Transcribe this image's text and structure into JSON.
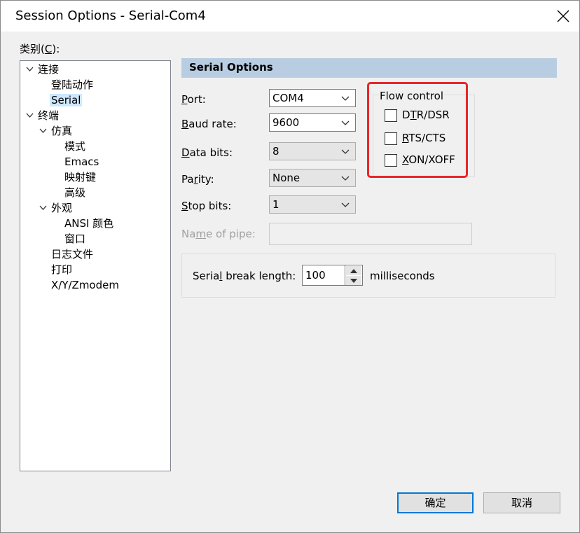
{
  "window": {
    "title": "Session Options - Serial-Com4"
  },
  "category": {
    "label_pre": "类别(",
    "label_key": "C",
    "label_post": "):"
  },
  "tree": {
    "connection": "连接",
    "logon_actions": "登陆动作",
    "serial": "Serial",
    "terminal": "终端",
    "emulation": "仿真",
    "modes": "模式",
    "emacs": "Emacs",
    "mapped_keys": "映射键",
    "advanced": "高级",
    "appearance": "外观",
    "ansi_color": "ANSI 颜色",
    "window": "窗口",
    "log_file": "日志文件",
    "printing": "打印",
    "xyzmodem": "X/Y/Zmodem",
    "selected": "Serial"
  },
  "section": {
    "title": "Serial Options"
  },
  "form": {
    "port_key": "P",
    "port_rest": "ort:",
    "baud_key": "B",
    "baud_rest": "aud rate:",
    "databits_key": "D",
    "databits_rest": "ata bits:",
    "parity_pre": "Pa",
    "parity_key": "r",
    "parity_rest": "ity:",
    "stopbits_key": "S",
    "stopbits_rest": "top bits:",
    "pipe_pre": "Na",
    "pipe_key": "m",
    "pipe_rest": "e of pipe:",
    "port_value": "COM4",
    "baud_value": "9600",
    "databits_value": "8",
    "parity_value": "None",
    "stopbits_value": "1",
    "pipe_value": ""
  },
  "flow_control": {
    "title": "Flow control",
    "dtr_pre": "D",
    "dtr_key": "T",
    "dtr_rest": "R/DSR",
    "rts_key": "R",
    "rts_rest": "TS/CTS",
    "xon_key": "X",
    "xon_rest": "ON/XOFF",
    "dtr_checked": false,
    "rts_checked": false,
    "xon_checked": false
  },
  "serial_break": {
    "label_pre": "Seria",
    "label_key": "l",
    "label_rest": " break length:",
    "value": "100",
    "unit": "milliseconds"
  },
  "buttons": {
    "ok": "确定",
    "cancel": "取消"
  },
  "colors": {
    "selection": "#cce8ff",
    "section_header": "#b9cde2",
    "highlight": "#e8262a",
    "default_button_border": "#0078d7"
  }
}
